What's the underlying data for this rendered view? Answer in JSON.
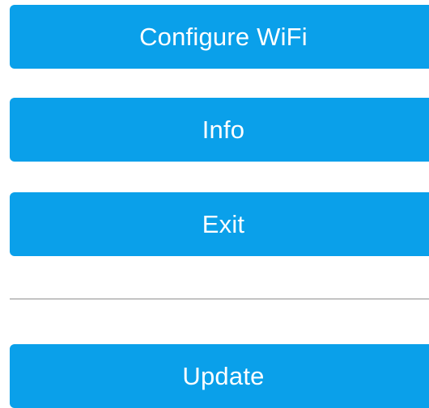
{
  "menu": {
    "configure_wifi_label": "Configure WiFi",
    "info_label": "Info",
    "exit_label": "Exit",
    "update_label": "Update"
  },
  "colors": {
    "button_background": "#0aa0ea",
    "button_text": "#ffffff",
    "divider": "#bdbdbd",
    "page_background": "#ffffff"
  }
}
